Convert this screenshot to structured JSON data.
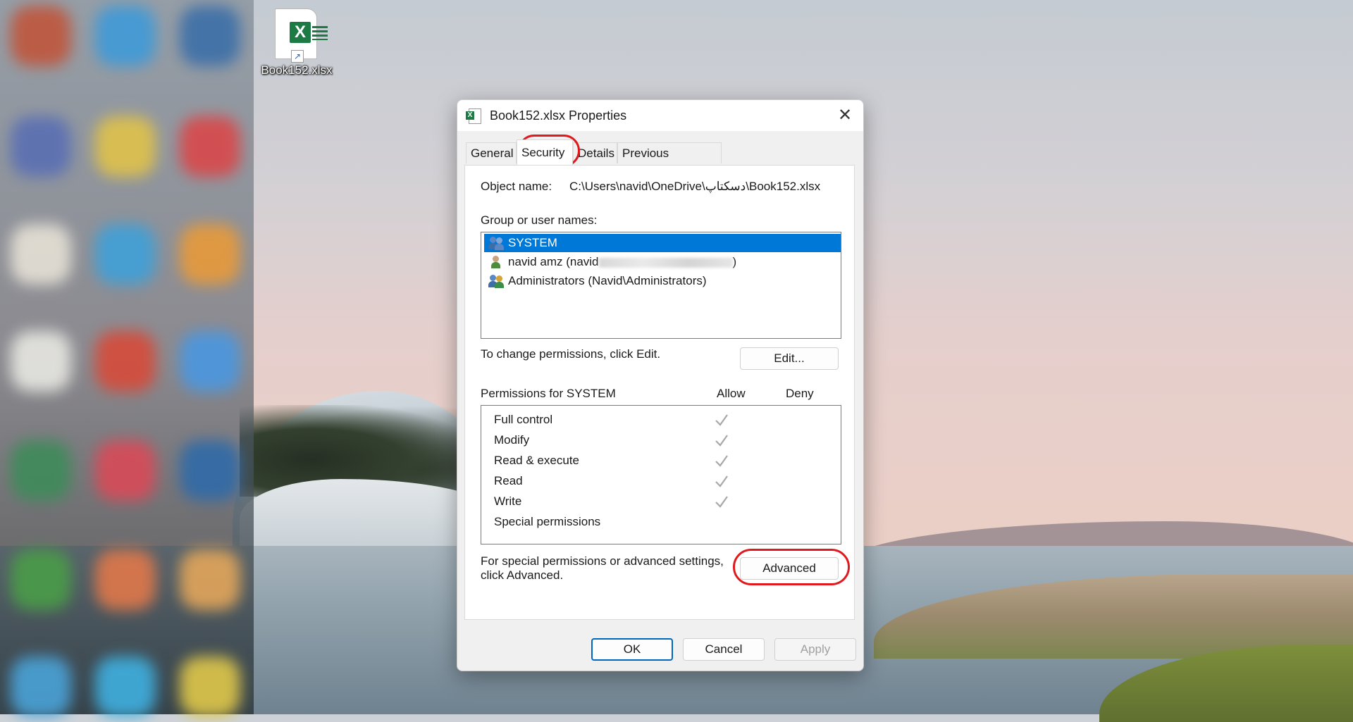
{
  "desktop": {
    "file_icon_label": "Book152.xlsx",
    "blurred_icon_colors": [
      "#c0563c",
      "#3f9ad8",
      "#3c6fa8",
      "#5a6fb3",
      "#e0c24a",
      "#d9484a",
      "#e6e1d6",
      "#3fa0d8",
      "#e89a3a",
      "#e7e7e2",
      "#d64b3a",
      "#4a97e0",
      "#3e8b5a",
      "#d94a58",
      "#2f6aa8",
      "#4a9d48",
      "#e0784a",
      "#e3a65a",
      "#4aa3d8",
      "#3fb0e0",
      "#e0c84a"
    ]
  },
  "dialog": {
    "title": "Book152.xlsx Properties",
    "close_glyph": "✕",
    "tabs": [
      {
        "label": "General"
      },
      {
        "label": "Security"
      },
      {
        "label": "Details"
      },
      {
        "label": "Previous Versions"
      }
    ],
    "active_tab": "Security",
    "object_name_label": "Object name:",
    "object_name_value": "C:\\Users\\navid\\OneDrive\\دسکتاپ\\Book152.xlsx",
    "group_label": "Group or user names:",
    "users": [
      {
        "name": "SYSTEM",
        "selected": true,
        "icon": "group-users-icon"
      },
      {
        "name": "navid amz (navid",
        "name_suffix": ")",
        "selected": false,
        "icon": "user-icon"
      },
      {
        "name": "Administrators (Navid\\Administrators)",
        "selected": false,
        "icon": "admin-users-icon"
      }
    ],
    "change_perm_text": "To change permissions, click Edit.",
    "edit_button": "Edit...",
    "permissions_label": "Permissions for SYSTEM",
    "allow_header": "Allow",
    "deny_header": "Deny",
    "permissions": [
      {
        "name": "Full control",
        "allow": true,
        "deny": false
      },
      {
        "name": "Modify",
        "allow": true,
        "deny": false
      },
      {
        "name": "Read & execute",
        "allow": true,
        "deny": false
      },
      {
        "name": "Read",
        "allow": true,
        "deny": false
      },
      {
        "name": "Write",
        "allow": true,
        "deny": false
      },
      {
        "name": "Special permissions",
        "allow": false,
        "deny": false
      }
    ],
    "advanced_text_line1": "For special permissions or advanced settings,",
    "advanced_text_line2": "click Advanced.",
    "advanced_button": "Advanced",
    "ok_button": "OK",
    "cancel_button": "Cancel",
    "apply_button": "Apply",
    "accent_color": "#0078d7",
    "highlight_color": "#e0191e"
  }
}
